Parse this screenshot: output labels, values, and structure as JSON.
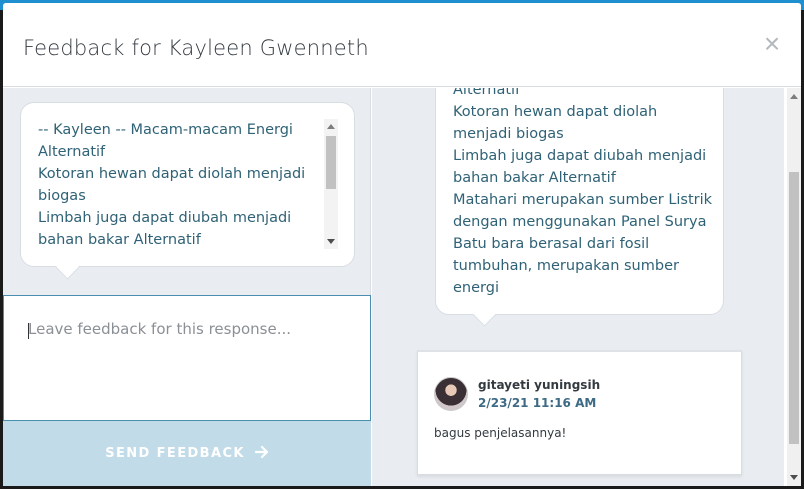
{
  "modal": {
    "title": "Feedback for Kayleen Gwenneth",
    "close_glyph": "×"
  },
  "response_left": {
    "lines": [
      "-- Kayleen --  Macam-macam Energi Alternatif",
      "Kotoran hewan dapat diolah menjadi biogas",
      "Limbah juga dapat diubah menjadi bahan bakar Alternatif"
    ]
  },
  "feedback": {
    "placeholder": "Leave feedback for this response...",
    "value": "",
    "send_label": "SEND FEEDBACK",
    "send_icon": "arrow-right-icon"
  },
  "response_right": {
    "lines": [
      "Alternatif",
      "Kotoran hewan dapat diolah menjadi biogas",
      "Limbah juga dapat diubah menjadi bahan bakar Alternatif",
      "Matahari merupakan sumber Listrik dengan menggunakan Panel Surya",
      "Batu bara berasal dari fosil tumbuhan, merupakan sumber energi"
    ]
  },
  "comment": {
    "author": "gitayeti yuningsih",
    "date": "2/23/21 11:16 AM",
    "text": "bagus penjelasannya!"
  },
  "colors": {
    "accent": "#1f8fcf",
    "text_teal": "#2f6276",
    "send_button_bg": "#c2dbe8",
    "panel_bg": "#e9edf1"
  }
}
